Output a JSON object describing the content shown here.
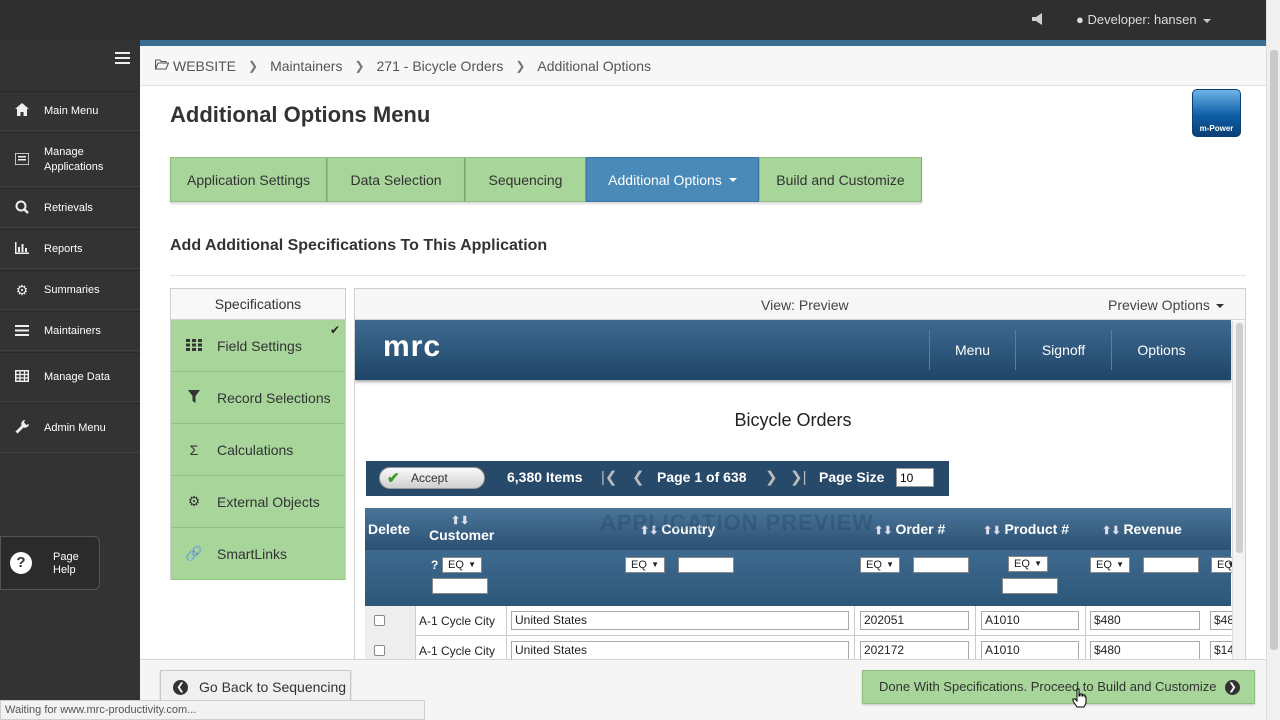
{
  "topbar": {
    "user_label": "Developer: hansen"
  },
  "sidebar": {
    "items": [
      {
        "label": "Main Menu",
        "icon": "home-icon"
      },
      {
        "label": "Manage Applications",
        "icon": "list-icon"
      },
      {
        "label": "Retrievals",
        "icon": "search-icon"
      },
      {
        "label": "Reports",
        "icon": "bar-chart-icon"
      },
      {
        "label": "Summaries",
        "icon": "gear-icon"
      },
      {
        "label": "Maintainers",
        "icon": "lines-icon"
      },
      {
        "label": "Manage Data",
        "icon": "table-icon"
      },
      {
        "label": "Admin Menu",
        "icon": "wrench-icon"
      }
    ],
    "help": {
      "line1": "Page",
      "line2": "Help"
    }
  },
  "breadcrumb": [
    "WEBSITE",
    "Maintainers",
    "271 - Bicycle Orders",
    "Additional Options"
  ],
  "page": {
    "title": "Additional Options Menu",
    "logo_text": "m-Power",
    "subtitle": "Add Additional Specifications To This Application"
  },
  "tabs": [
    "Application Settings",
    "Data Selection",
    "Sequencing",
    "Additional Options",
    "Build and Customize"
  ],
  "specs": {
    "header": "Specifications",
    "items": [
      "Field Settings",
      "Record Selections",
      "Calculations",
      "External Objects",
      "SmartLinks"
    ]
  },
  "preview": {
    "view_label": "View: Preview",
    "options_label": "Preview Options",
    "brand": "mrc",
    "nav": [
      "Menu",
      "Signoff",
      "Options"
    ],
    "title": "Bicycle Orders",
    "accept_label": "Accept",
    "items_count": "6,380 Items",
    "page_info": "Page 1 of 638",
    "page_size_label": "Page Size",
    "page_size": "10",
    "watermark": "APPLICATION PREVIEW",
    "columns": [
      "Delete",
      "Customer",
      "Country",
      "Order #",
      "Product #",
      "Revenue"
    ],
    "filter_op": "EQ",
    "help_mark": "?",
    "rows": [
      {
        "customer": "A-1 Cycle City",
        "country": "United States",
        "order": "202051",
        "product": "A1010",
        "revenue": "$480",
        "extra": "$48"
      },
      {
        "customer": "A-1 Cycle City",
        "country": "United States",
        "order": "202172",
        "product": "A1010",
        "revenue": "$480",
        "extra": "$14"
      }
    ]
  },
  "footer": {
    "back_label": "Go Back to Sequencing",
    "done_label": "Done With Specifications. Proceed to Build and Customize",
    "status": "Waiting for www.mrc-productivity.com..."
  },
  "colors": {
    "accent_green": "#a8d59a",
    "active_blue": "#4a8ab9",
    "sidebar_bg": "#333333"
  }
}
